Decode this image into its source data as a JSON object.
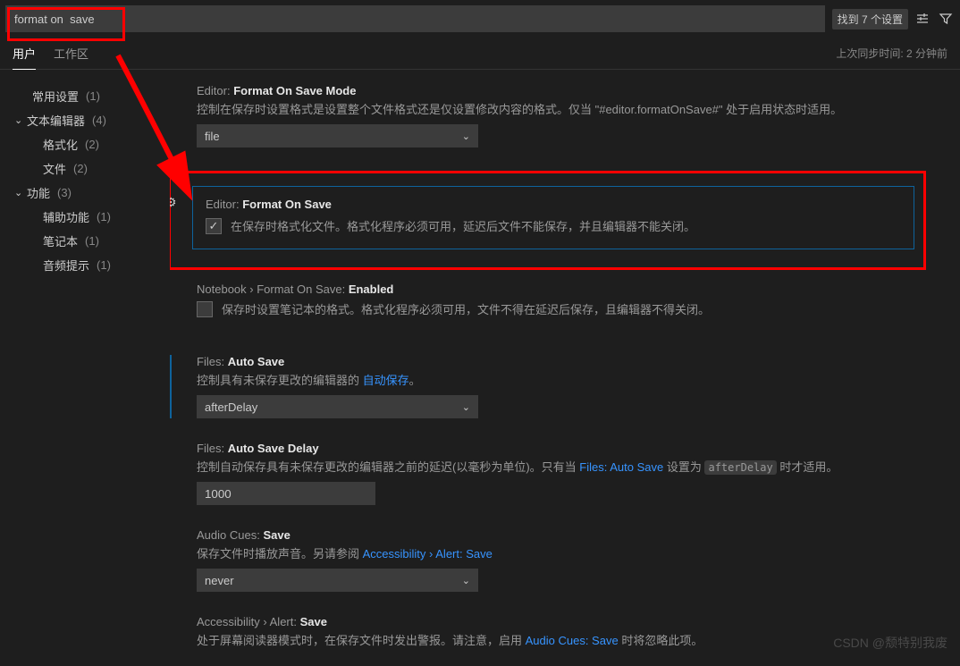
{
  "search": {
    "value": "format on  save",
    "found": "找到 7 个设置"
  },
  "tabs": {
    "user": "用户",
    "workspace": "工作区",
    "sync": "上次同步时间: 2 分钟前"
  },
  "sidebar": {
    "common": {
      "label": "常用设置",
      "count": "(1)"
    },
    "textEditor": {
      "label": "文本编辑器",
      "count": "(4)"
    },
    "formatting": {
      "label": "格式化",
      "count": "(2)"
    },
    "files": {
      "label": "文件",
      "count": "(2)"
    },
    "features": {
      "label": "功能",
      "count": "(3)"
    },
    "accessibility": {
      "label": "辅助功能",
      "count": "(1)"
    },
    "notebook": {
      "label": "笔记本",
      "count": "(1)"
    },
    "audioCues": {
      "label": "音频提示",
      "count": "(1)"
    }
  },
  "settings": {
    "formatOnSaveMode": {
      "prefix": "Editor:",
      "name": "Format On Save Mode",
      "desc": "控制在保存时设置格式是设置整个文件格式还是仅设置修改内容的格式。仅当 \"#editor.formatOnSave#\" 处于启用状态时适用。",
      "value": "file"
    },
    "formatOnSave": {
      "prefix": "Editor:",
      "name": "Format On Save",
      "desc": "在保存时格式化文件。格式化程序必须可用，延迟后文件不能保存，并且编辑器不能关闭。"
    },
    "notebookFormatOnSave": {
      "prefix": "Notebook › Format On Save:",
      "name": "Enabled",
      "desc": "保存时设置笔记本的格式。格式化程序必须可用，文件不得在延迟后保存，且编辑器不得关闭。"
    },
    "autoSave": {
      "prefix": "Files:",
      "name": "Auto Save",
      "desc1": "控制具有未保存更改的编辑器的 ",
      "link": "自动保存",
      "desc2": "。",
      "value": "afterDelay"
    },
    "autoSaveDelay": {
      "prefix": "Files:",
      "name": "Auto Save Delay",
      "desc1": "控制自动保存具有未保存更改的编辑器之前的延迟(以毫秒为单位)。只有当 ",
      "link": "Files: Auto Save",
      "desc2": " 设置为 ",
      "code": "afterDelay",
      "desc3": " 时才适用。",
      "value": "1000"
    },
    "audioCuesSave": {
      "prefix": "Audio Cues:",
      "name": "Save",
      "desc1": "保存文件时播放声音。另请参阅 ",
      "link": "Accessibility › Alert: Save",
      "value": "never"
    },
    "accessibilityAlert": {
      "prefix": "Accessibility › Alert:",
      "name": "Save",
      "desc1": "处于屏幕阅读器模式时，在保存文件时发出警报。请注意，启用 ",
      "link": "Audio Cues: Save",
      "desc2": " 时将忽略此项。"
    }
  },
  "watermark": "CSDN @颓特别我废"
}
